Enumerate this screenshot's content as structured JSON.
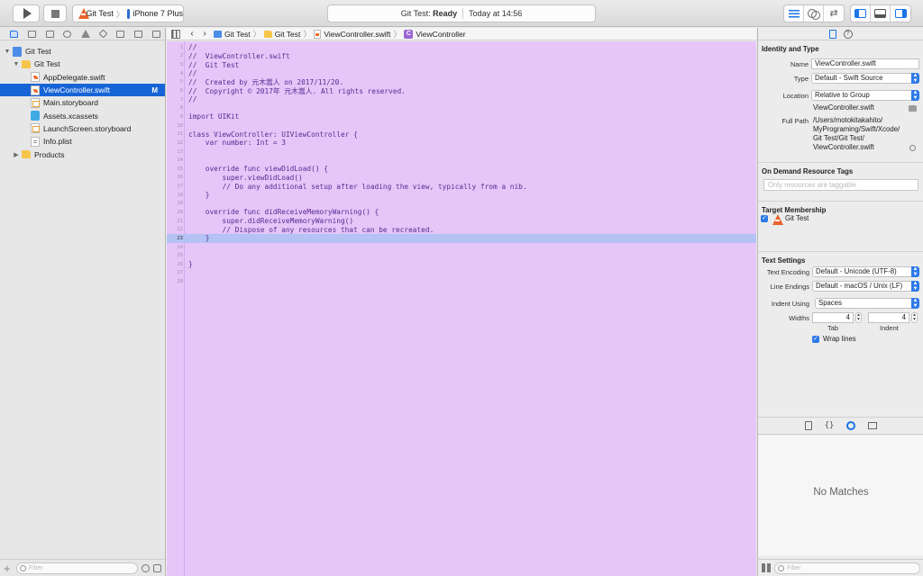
{
  "toolbar": {
    "scheme_name": "Git Test",
    "device_name": "iPhone 7 Plus",
    "status_project": "Git Test:",
    "status_state": "Ready",
    "status_time": "Today at 14:56"
  },
  "navigator": {
    "filter_placeholder": "Filter",
    "items": [
      {
        "label": "Git Test",
        "type": "project",
        "level": 0,
        "disclosure": "open"
      },
      {
        "label": "Git Test",
        "type": "folder",
        "level": 1,
        "disclosure": "open"
      },
      {
        "label": "AppDelegate.swift",
        "type": "swift",
        "level": 2
      },
      {
        "label": "ViewController.swift",
        "type": "swift",
        "level": 2,
        "selected": true,
        "badge": "M"
      },
      {
        "label": "Main.storyboard",
        "type": "storyboard",
        "level": 2
      },
      {
        "label": "Assets.xcassets",
        "type": "assets",
        "level": 2
      },
      {
        "label": "LaunchScreen.storyboard",
        "type": "storyboard",
        "level": 2
      },
      {
        "label": "Info.plist",
        "type": "plist",
        "level": 2
      },
      {
        "label": "Products",
        "type": "folder",
        "level": 1,
        "disclosure": "closed"
      }
    ]
  },
  "jumpbar": {
    "items": [
      "Git Test",
      "Git Test",
      "ViewController.swift",
      "ViewController"
    ],
    "class_glyph": "C"
  },
  "editor": {
    "current_line": 23,
    "lines": [
      {
        "n": "1",
        "text": "//",
        "style": "comment"
      },
      {
        "n": "2",
        "text": "//  ViewController.swift",
        "style": "comment"
      },
      {
        "n": "3",
        "text": "//  Git Test",
        "style": "comment"
      },
      {
        "n": "4",
        "text": "//",
        "style": "comment"
      },
      {
        "n": "5",
        "text": "//  Created by 元木嵩人 on 2017/11/20.",
        "style": "comment"
      },
      {
        "n": "6",
        "text": "//  Copyright © 2017年 元木嵩人. All rights reserved.",
        "style": "comment"
      },
      {
        "n": "7",
        "text": "//",
        "style": "comment"
      },
      {
        "n": "8",
        "text": "",
        "style": "plain"
      },
      {
        "n": "9",
        "text": "import UIKit",
        "style": "kw"
      },
      {
        "n": "10",
        "text": "",
        "style": "plain"
      },
      {
        "n": "11",
        "text": "class ViewController: UIViewController {",
        "style": "kw"
      },
      {
        "n": "12",
        "text": "    var number: Int = 3",
        "style": "kw"
      },
      {
        "n": "13",
        "text": "",
        "style": "plain"
      },
      {
        "n": "14",
        "text": "",
        "style": "plain"
      },
      {
        "n": "15",
        "text": "    override func viewDidLoad() {",
        "style": "kw"
      },
      {
        "n": "16",
        "text": "        super.viewDidLoad()",
        "style": "call"
      },
      {
        "n": "17",
        "text": "        // Do any additional setup after loading the view, typically from a nib.",
        "style": "comment"
      },
      {
        "n": "18",
        "text": "    }",
        "style": "plain"
      },
      {
        "n": "19",
        "text": "",
        "style": "plain"
      },
      {
        "n": "20",
        "text": "    override func didReceiveMemoryWarning() {",
        "style": "kw"
      },
      {
        "n": "21",
        "text": "        super.didReceiveMemoryWarning()",
        "style": "call"
      },
      {
        "n": "22",
        "text": "        // Dispose of any resources that can be recreated.",
        "style": "comment"
      },
      {
        "n": "23",
        "text": "    }",
        "style": "plain"
      },
      {
        "n": "24",
        "text": "",
        "style": "plain"
      },
      {
        "n": "25",
        "text": "",
        "style": "plain"
      },
      {
        "n": "26",
        "text": "}",
        "style": "plain"
      },
      {
        "n": "27",
        "text": "",
        "style": "plain"
      },
      {
        "n": "28",
        "text": "",
        "style": "plain"
      }
    ]
  },
  "inspector": {
    "identity": {
      "title": "Identity and Type",
      "name_label": "Name",
      "name_value": "ViewController.swift",
      "type_label": "Type",
      "type_value": "Default - Swift Source",
      "location_label": "Location",
      "location_value": "Relative to Group",
      "location_file": "ViewController.swift",
      "full_path_label": "Full Path",
      "full_path_lines": [
        "/Users/motokitakahito/",
        "MyPrograming/Swift/Xcode/",
        "Git Test/Git Test/",
        "ViewController.swift"
      ]
    },
    "on_demand": {
      "title": "On Demand Resource Tags",
      "placeholder": "Only resources are taggable"
    },
    "target": {
      "title": "Target Membership",
      "target_name": "Git Test",
      "checked": true
    },
    "text_settings": {
      "title": "Text Settings",
      "encoding_label": "Text Encoding",
      "encoding_value": "Default - Unicode (UTF-8)",
      "line_endings_label": "Line Endings",
      "line_endings_value": "Default - macOS / Unix (LF)",
      "indent_using_label": "Indent Using",
      "indent_using_value": "Spaces",
      "widths_label": "Widths",
      "tab_value": "4",
      "indent_value": "4",
      "tab_label": "Tab",
      "indent_label": "Indent",
      "wrap_lines_label": "Wrap lines",
      "wrap_lines_checked": true
    },
    "library": {
      "empty_text": "No Matches",
      "filter_placeholder": "Filter"
    }
  },
  "colors": {
    "editor_background": "#e6c5f8",
    "current_line_highlight": "#b5c2f4",
    "selection": "#1764d6",
    "accent": "#2d7ae9"
  }
}
